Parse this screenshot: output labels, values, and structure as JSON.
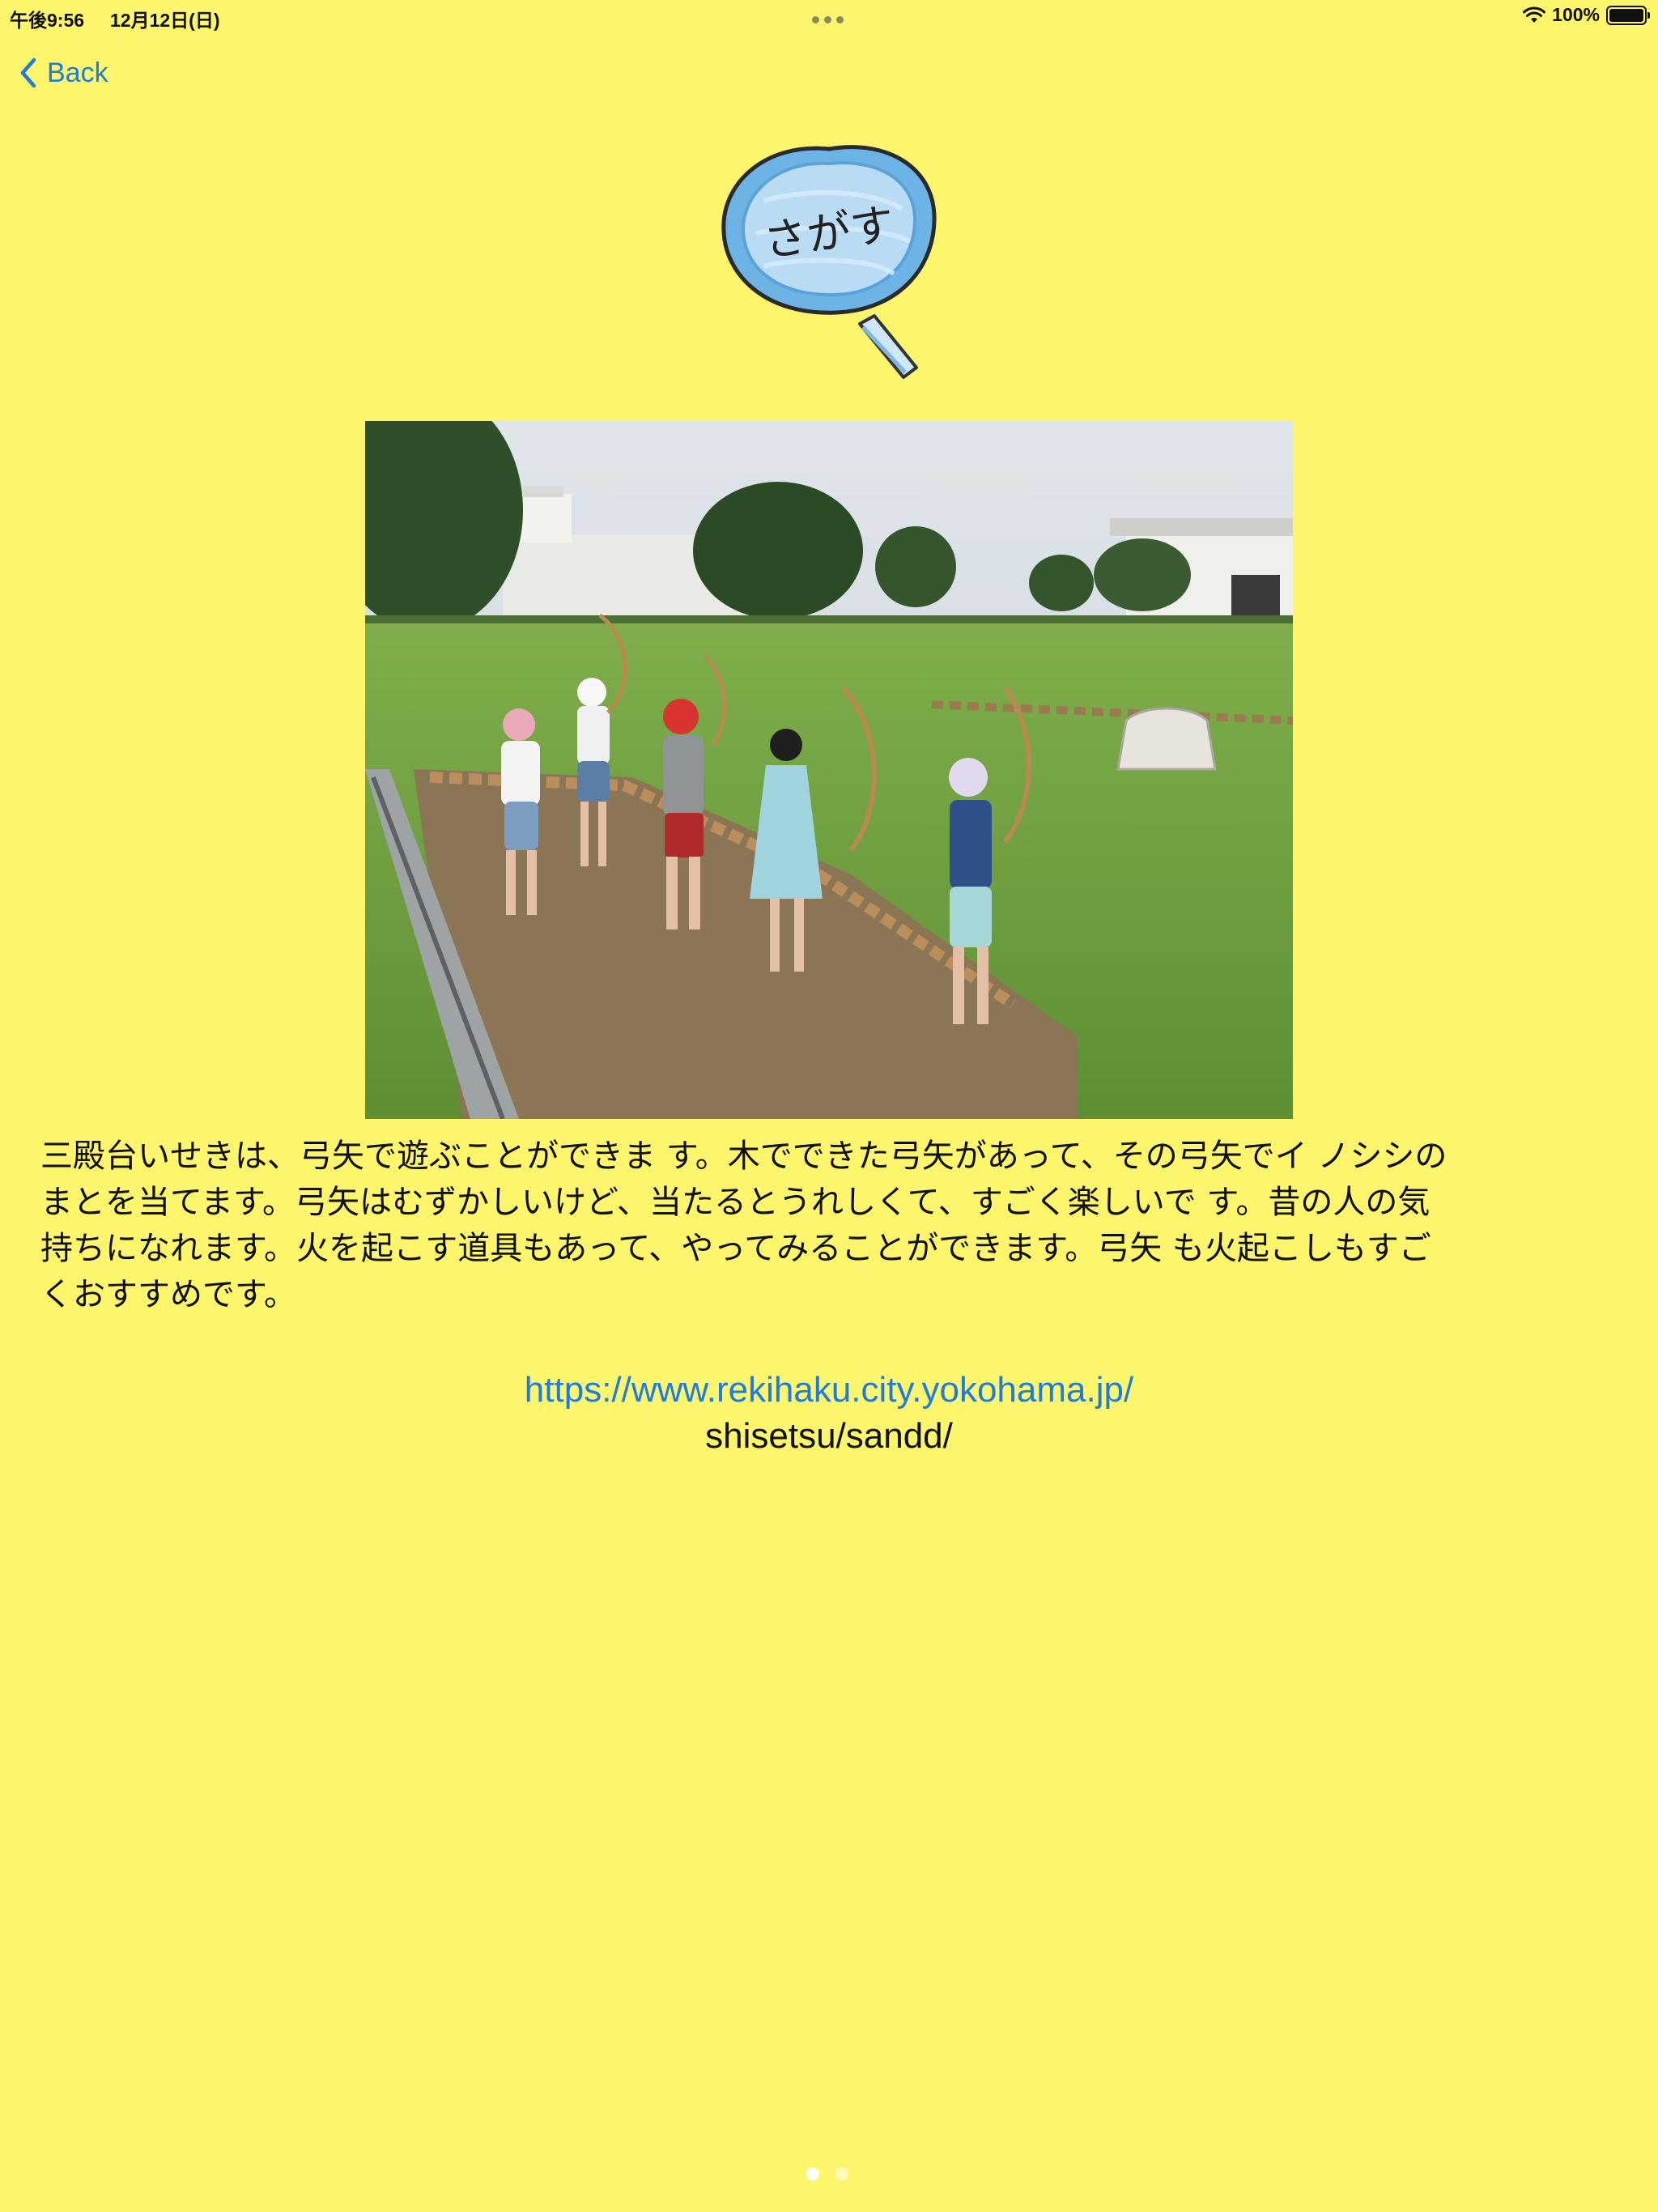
{
  "status_bar": {
    "time": "午後9:56",
    "date": "12月12日(日)",
    "battery": "100%",
    "wifi_icon": "wifi-icon",
    "battery_icon": "battery-icon"
  },
  "nav": {
    "back_label": "Back",
    "back_icon": "chevron-left-icon"
  },
  "logo": {
    "text": "さがす",
    "icon": "magnifying-glass-icon"
  },
  "main": {
    "description": "三殿台いせきは、弓矢で遊ぶことができま す。木でできた弓矢があって、その弓矢でイ ノシシの\nまとを当てます。弓矢はむずかしいけど、当たるとうれしくて、すごく楽しいで す。昔の人の気\n持ちになれます。火を起こす道具もあって、やってみることができます。弓矢 も火起こしもすご\nくおすすめです。",
    "link_url": "https://www.rekihaku.city.yokohama.jp/",
    "link_rest": "shisetsu/sandd/"
  },
  "pagination": {
    "total": 2,
    "current": 1
  },
  "colors": {
    "background": "#FDF66C",
    "accent": "#1E7BE0"
  }
}
